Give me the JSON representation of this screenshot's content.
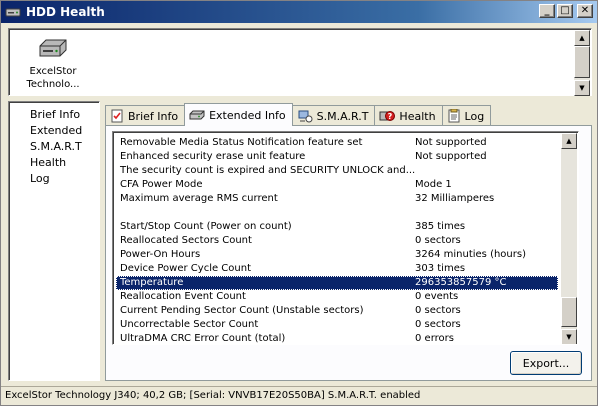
{
  "window": {
    "title": "HDD Health",
    "buttons": {
      "minimize": "_",
      "maximize": "□",
      "close": "✕"
    }
  },
  "drives": [
    {
      "label_line1": "ExcelStor",
      "label_line2": "Technolo...",
      "icon": "hard-drive-icon"
    }
  ],
  "nav": {
    "items": [
      {
        "label": "Brief Info"
      },
      {
        "label": "Extended"
      },
      {
        "label": "S.M.A.R.T"
      },
      {
        "label": "Health"
      },
      {
        "label": "Log"
      }
    ]
  },
  "tabs": [
    {
      "label": "Brief Info",
      "icon": "checklist-icon"
    },
    {
      "label": "Extended Info",
      "icon": "drive-icon"
    },
    {
      "label": "S.M.A.R.T",
      "icon": "network-drive-icon"
    },
    {
      "label": "Health",
      "icon": "health-icon"
    },
    {
      "label": "Log",
      "icon": "log-icon"
    }
  ],
  "active_tab": "Extended Info",
  "info_rows": [
    {
      "key": "Removable Media Status Notification feature set",
      "value": "Not supported"
    },
    {
      "key": "Enhanced security erase unit feature",
      "value": "Not supported"
    },
    {
      "key": "The security count is expired and SECURITY UNLOCK and...",
      "value": ""
    },
    {
      "key": "CFA Power Mode",
      "value": "Mode 1"
    },
    {
      "key": "Maximum average RMS current",
      "value": "32 Milliamperes"
    },
    {
      "key": "",
      "value": ""
    },
    {
      "key": "Start/Stop Count (Power on count)",
      "value": "385 times"
    },
    {
      "key": "Reallocated Sectors Count",
      "value": "0 sectors"
    },
    {
      "key": "Power-On Hours",
      "value": "3264 minuties (hours)"
    },
    {
      "key": "Device Power Cycle Count",
      "value": "303 times"
    },
    {
      "key": "Temperature",
      "value": "296353857579 °C",
      "selected": true
    },
    {
      "key": "Reallocation Event Count",
      "value": "0 events"
    },
    {
      "key": "Current Pending Sector Count (Unstable sectors)",
      "value": "0 sectors"
    },
    {
      "key": "Uncorrectable Sector Count",
      "value": "0 sectors"
    },
    {
      "key": "UltraDMA CRC Error Count (total)",
      "value": "0 errors"
    }
  ],
  "export_label": "Export...",
  "status": "ExcelStor Technology J340;  40,2 GB;  [Serial: VNVB17E20S50BA]  S.M.A.R.T. enabled",
  "colors": {
    "selection": "#0a246a",
    "title_start": "#0a246a"
  }
}
